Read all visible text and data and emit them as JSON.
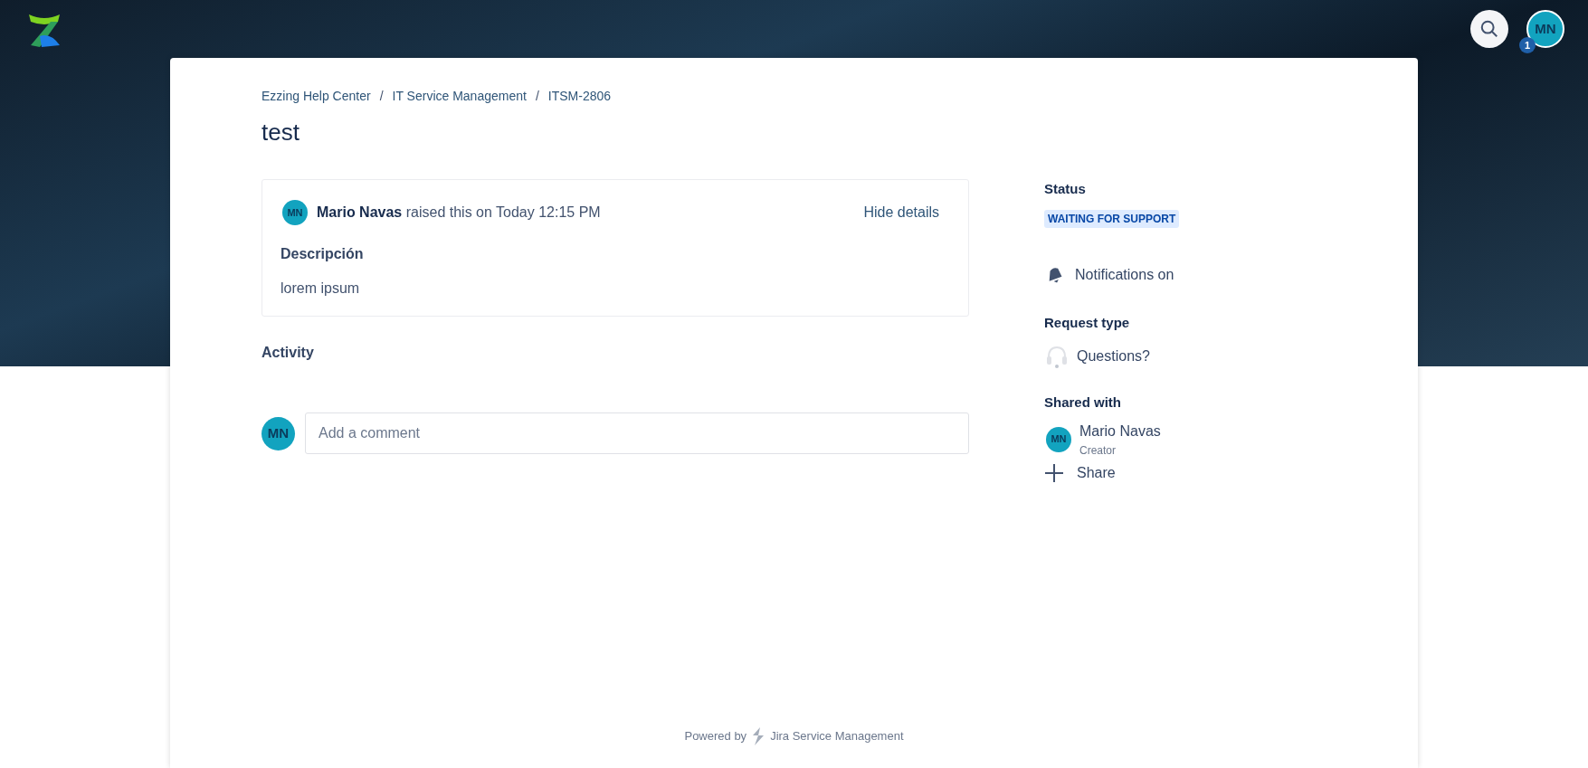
{
  "header": {
    "user_initials": "MN",
    "notification_count": "1"
  },
  "breadcrumbs": [
    {
      "kind": "link",
      "text": "Ezzing Help Center"
    },
    {
      "kind": "separator",
      "text": "/"
    },
    {
      "kind": "link",
      "text": "IT Service Management"
    },
    {
      "kind": "separator",
      "text": "/"
    },
    {
      "kind": "link",
      "text": "ITSM-2806"
    }
  ],
  "title": "test",
  "request": {
    "reporter_initials": "MN",
    "reporter": "Mario Navas",
    "raised_text": "raised this on Today 12:15 PM",
    "toggle": "Hide details",
    "fields": [
      {
        "label": "Descripción",
        "value": "lorem ipsum"
      }
    ]
  },
  "activity": {
    "heading": "Activity",
    "user_initials": "MN",
    "comment_placeholder": "Add a comment"
  },
  "sidebar": {
    "status_label": "Status",
    "status": "WAITING FOR SUPPORT",
    "notifications": "Notifications on",
    "request_type_label": "Request type",
    "request_type": "Questions?",
    "shared_with_label": "Shared with",
    "participants": [
      {
        "initials": "MN",
        "name": "Mario Navas",
        "role": "Creator"
      }
    ],
    "share": "Share"
  },
  "footer": {
    "powered_by": "Powered by",
    "product": "Jira Service Management"
  }
}
